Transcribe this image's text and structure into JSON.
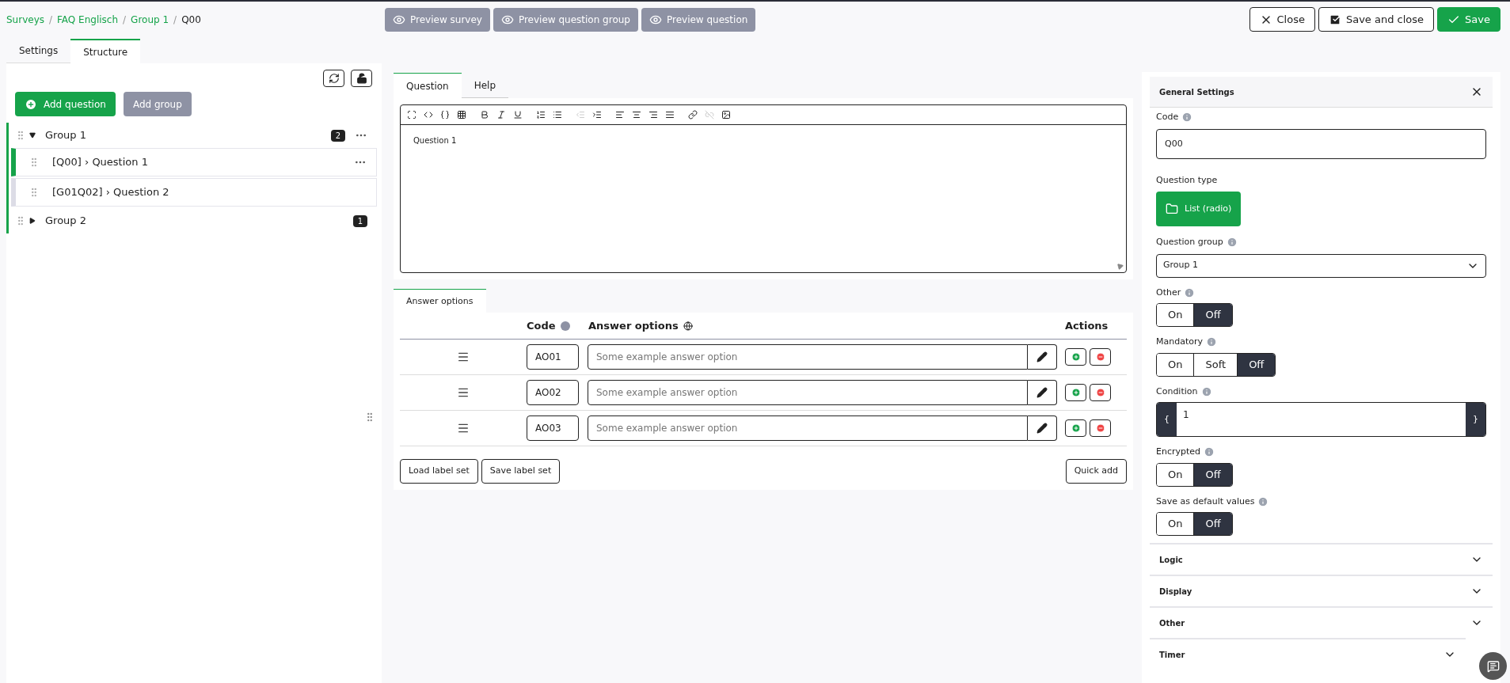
{
  "breadcrumb": [
    {
      "kind": "link",
      "label": "Surveys"
    },
    {
      "kind": "separator",
      "label": "/"
    },
    {
      "kind": "link",
      "label": "FAQ Englisch"
    },
    {
      "kind": "separator",
      "label": "/"
    },
    {
      "kind": "link",
      "label": "Group 1"
    },
    {
      "kind": "separator",
      "label": "/"
    },
    {
      "kind": "current",
      "label": "Q00"
    }
  ],
  "preview_buttons": [
    "Preview survey",
    "Preview question group",
    "Preview question"
  ],
  "actions": [
    {
      "kind": "close",
      "label": "Close"
    },
    {
      "kind": "save_close",
      "label": "Save and close"
    },
    {
      "kind": "save",
      "label": "Save"
    }
  ],
  "side_tabs": [
    {
      "label": "Settings",
      "selected": false
    },
    {
      "label": "Structure",
      "selected": true
    }
  ],
  "structure": {
    "add_question": "Add question",
    "add_group": "Add group",
    "groups": [
      {
        "name": "Group 1",
        "count": "2",
        "expanded": true,
        "children": [
          {
            "label": "[Q00] › Question 1",
            "selected": true
          },
          {
            "label": "[G01Q02] › Question 2",
            "selected": false
          }
        ]
      },
      {
        "name": "Group 2",
        "count": "1",
        "expanded": false
      }
    ]
  },
  "editor_tabs": [
    {
      "label": "Question",
      "selected": true
    },
    {
      "label": "Help",
      "selected": false
    }
  ],
  "toolbar": [
    {
      "kind": "fullscreen",
      "disabled": false
    },
    {
      "kind": "source",
      "disabled": false
    },
    {
      "kind": "expression",
      "disabled": false
    },
    {
      "kind": "table",
      "disabled": false
    },
    {
      "kind": "bold",
      "disabled": false
    },
    {
      "kind": "italic",
      "disabled": false
    },
    {
      "kind": "underline",
      "disabled": false
    },
    {
      "kind": "numbered",
      "disabled": false
    },
    {
      "kind": "bulleted",
      "disabled": false
    },
    {
      "kind": "outdent",
      "disabled": true
    },
    {
      "kind": "indent",
      "disabled": false
    },
    {
      "kind": "align_left",
      "disabled": false
    },
    {
      "kind": "align_center",
      "disabled": false
    },
    {
      "kind": "align_right",
      "disabled": false
    },
    {
      "kind": "justify",
      "disabled": false
    },
    {
      "kind": "link",
      "disabled": false
    },
    {
      "kind": "unlink",
      "disabled": true
    },
    {
      "kind": "image",
      "disabled": false
    }
  ],
  "editor_text": "Question 1",
  "answers": {
    "tab": "Answer options",
    "columns": [
      "Code",
      "Answer options",
      "Actions"
    ],
    "rows": [
      {
        "code": "AO01",
        "placeholder": "Some example answer option"
      },
      {
        "code": "AO02",
        "placeholder": "Some example answer option"
      },
      {
        "code": "AO03",
        "placeholder": "Some example answer option"
      }
    ],
    "buttons": [
      "Load label set",
      "Save label set"
    ],
    "quick_add": "Quick add"
  },
  "settings": {
    "title": "General Settings",
    "code": {
      "label": "Code",
      "value": "Q00"
    },
    "question_type": {
      "label": "Question type",
      "value": "List (radio)"
    },
    "question_group": {
      "label": "Question group",
      "value": "Group 1"
    },
    "toggles": [
      {
        "label": "Other",
        "options": [
          {
            "label": "On",
            "selected": false
          },
          {
            "label": "Off",
            "selected": true
          }
        ]
      },
      {
        "label": "Mandatory",
        "options": [
          {
            "label": "On",
            "selected": false
          },
          {
            "label": "Soft",
            "selected": false
          },
          {
            "label": "Off",
            "selected": true
          }
        ]
      },
      {
        "kind": "condition",
        "label": "Condition",
        "open": "{",
        "value": "1",
        "close": "}"
      },
      {
        "label": "Encrypted",
        "options": [
          {
            "label": "On",
            "selected": false
          },
          {
            "label": "Off",
            "selected": true
          }
        ]
      },
      {
        "label": "Save as default values",
        "options": [
          {
            "label": "On",
            "selected": false
          },
          {
            "label": "Off",
            "selected": true
          }
        ]
      }
    ],
    "sections": [
      {
        "label": "Logic",
        "expanded": false
      },
      {
        "label": "Display",
        "expanded": false
      },
      {
        "label": "Other",
        "expanded": false
      },
      {
        "label": "Timer",
        "expanded": false
      }
    ]
  }
}
